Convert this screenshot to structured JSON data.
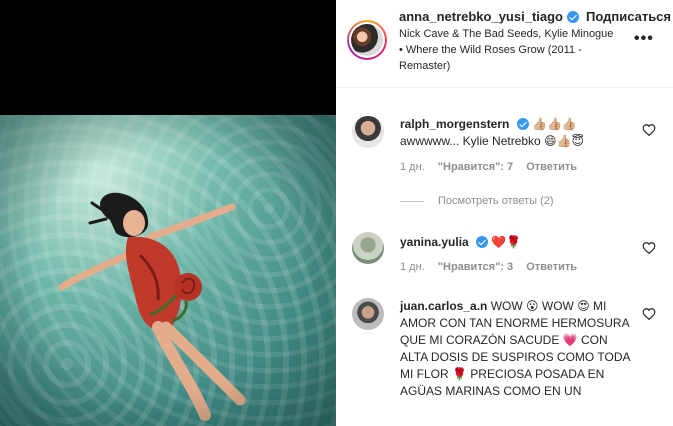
{
  "post": {
    "username": "anna_netrebko_yusi_tiago",
    "follow_label": "Подписаться",
    "song": "Nick Cave & The Bad Seeds, Kylie Minogue • Where the Wild Roses Grow (2011 - Remaster)",
    "more_icon": "more-horizontal-icon"
  },
  "comments": [
    {
      "username": "ralph_morgenstern",
      "verified": true,
      "text": "👍🏼👍🏼👍🏼 awwwww... Kylie Netrebko 😄👍🏼😇",
      "age": "1 дн.",
      "likes": "\"Нравится\": 7",
      "reply": "Ответить",
      "view_replies": "Посмотреть ответы (2)"
    },
    {
      "username": "yanina.yulia",
      "verified": true,
      "text": "❤️🌹",
      "age": "1 дн.",
      "likes": "\"Нравится\": 3",
      "reply": "Ответить"
    },
    {
      "username": "juan.carlos_a.n",
      "verified": false,
      "text": "WOW 😮 WOW 😍 MI AMOR CON TAN ENORME HERMOSURA QUE MI CORAZÓN SACUDE 💗 CON ALTA DOSIS DE SUSPIROS COMO TODA MI FLOR 🌹 PRECIOSA POSADA EN AGÜAS MARINAS COMO EN UN"
    }
  ],
  "colors": {
    "accent": "#3897f0",
    "muted": "#8e8e8e",
    "text": "#262626"
  }
}
